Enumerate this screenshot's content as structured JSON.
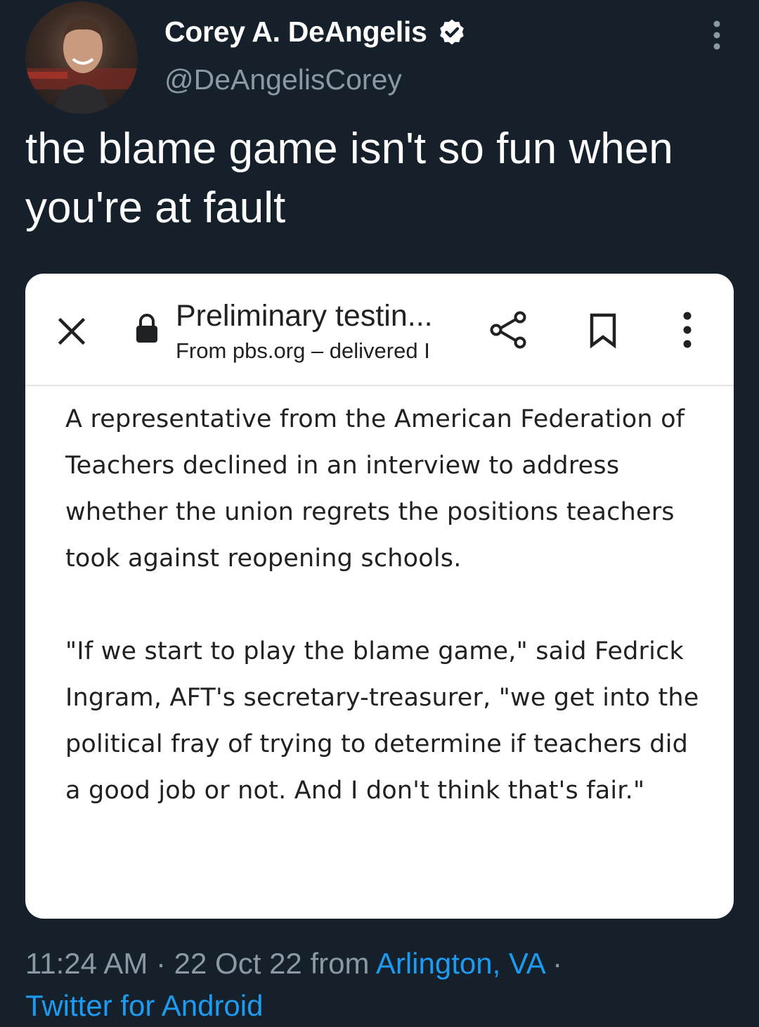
{
  "author": {
    "display_name": "Corey A. DeAngelis",
    "handle": "@DeAngelisCorey",
    "verified": true,
    "avatar_icon": "profile-photo"
  },
  "tweet": {
    "text": "the blame game isn't so fun when you're at fault"
  },
  "embedded_screenshot": {
    "title": "Preliminary testin...",
    "subtitle": "From pbs.org – delivered I",
    "icons": [
      "close-icon",
      "lock-icon",
      "share-icon",
      "bookmark-icon",
      "more-vertical-icon"
    ],
    "paragraphs": [
      "A representative from the American Federation of Teachers declined in an interview to address whether the union regrets the positions teachers took against reopening schools.",
      "\"If we start to play the blame game,\" said Fedrick Ingram, AFT's secretary-treasurer, \"we get into the political fray of trying to determine if teachers did a good job or not. And I don't think that's fair.\""
    ]
  },
  "meta": {
    "time": "11:24 AM",
    "separator": " · ",
    "date": "22 Oct 22",
    "from_label": " from ",
    "location": "Arlington, VA",
    "trailing_separator": " ·",
    "source": "Twitter for Android"
  },
  "colors": {
    "background": "#15202b",
    "text_primary": "#ffffff",
    "text_secondary": "#8b98a5",
    "link": "#1d9bf0",
    "card_background": "#ffffff"
  }
}
